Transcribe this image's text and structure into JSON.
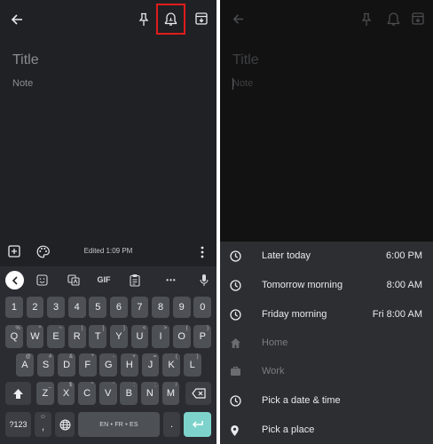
{
  "left": {
    "note": {
      "title_placeholder": "Title",
      "note_placeholder": "Note"
    },
    "bottom_bar": {
      "edited": "Edited 1:09 PM"
    },
    "toolbar_icons": [
      "back-arrow-icon",
      "pin-icon",
      "reminder-bell-icon",
      "archive-icon"
    ],
    "highlight_color": "#e01c1c",
    "keyboard": {
      "toolbar": {
        "gif_label": "GIF",
        "more_label": "•••"
      },
      "rows": [
        {
          "keys": [
            "1",
            "2",
            "3",
            "4",
            "5",
            "6",
            "7",
            "8",
            "9",
            "0"
          ]
        },
        {
          "keys": [
            "Q",
            "W",
            "E",
            "R",
            "T",
            "Y",
            "U",
            "I",
            "O",
            "P"
          ],
          "sup": [
            "%",
            "^",
            "~",
            "|",
            "[",
            "]",
            "<",
            ">",
            "{",
            "}"
          ]
        },
        {
          "keys": [
            "A",
            "S",
            "D",
            "F",
            "G",
            "H",
            "J",
            "K",
            "L"
          ],
          "sup": [
            "@",
            "#",
            "&",
            "*",
            "-",
            "+",
            "=",
            "(",
            ")"
          ]
        },
        {
          "keys": [
            "Z",
            "X",
            "C",
            "V",
            "B",
            "N",
            "M"
          ],
          "sup": [
            "_",
            "$",
            "\"",
            "'",
            ":",
            ";",
            "/"
          ]
        }
      ],
      "symbols_label": "?123",
      "comma_label": ",",
      "space_label": "EN • FR • ES",
      "period_label": ".",
      "enter_color": "#7dd3cb"
    }
  },
  "right": {
    "note": {
      "title_placeholder": "Title",
      "note_placeholder": "Note"
    },
    "reminder_options": [
      {
        "label": "Later today",
        "time": "6:00 PM",
        "icon": "clock-icon",
        "enabled": true
      },
      {
        "label": "Tomorrow morning",
        "time": "8:00 AM",
        "icon": "clock-icon",
        "enabled": true
      },
      {
        "label": "Friday morning",
        "time": "Fri 8:00 AM",
        "icon": "clock-icon",
        "enabled": true
      },
      {
        "label": "Home",
        "time": "",
        "icon": "home-icon",
        "enabled": false
      },
      {
        "label": "Work",
        "time": "",
        "icon": "briefcase-icon",
        "enabled": false
      },
      {
        "label": "Pick a date & time",
        "time": "",
        "icon": "clock-icon",
        "enabled": true
      },
      {
        "label": "Pick a place",
        "time": "",
        "icon": "location-pin-icon",
        "enabled": true
      }
    ]
  }
}
